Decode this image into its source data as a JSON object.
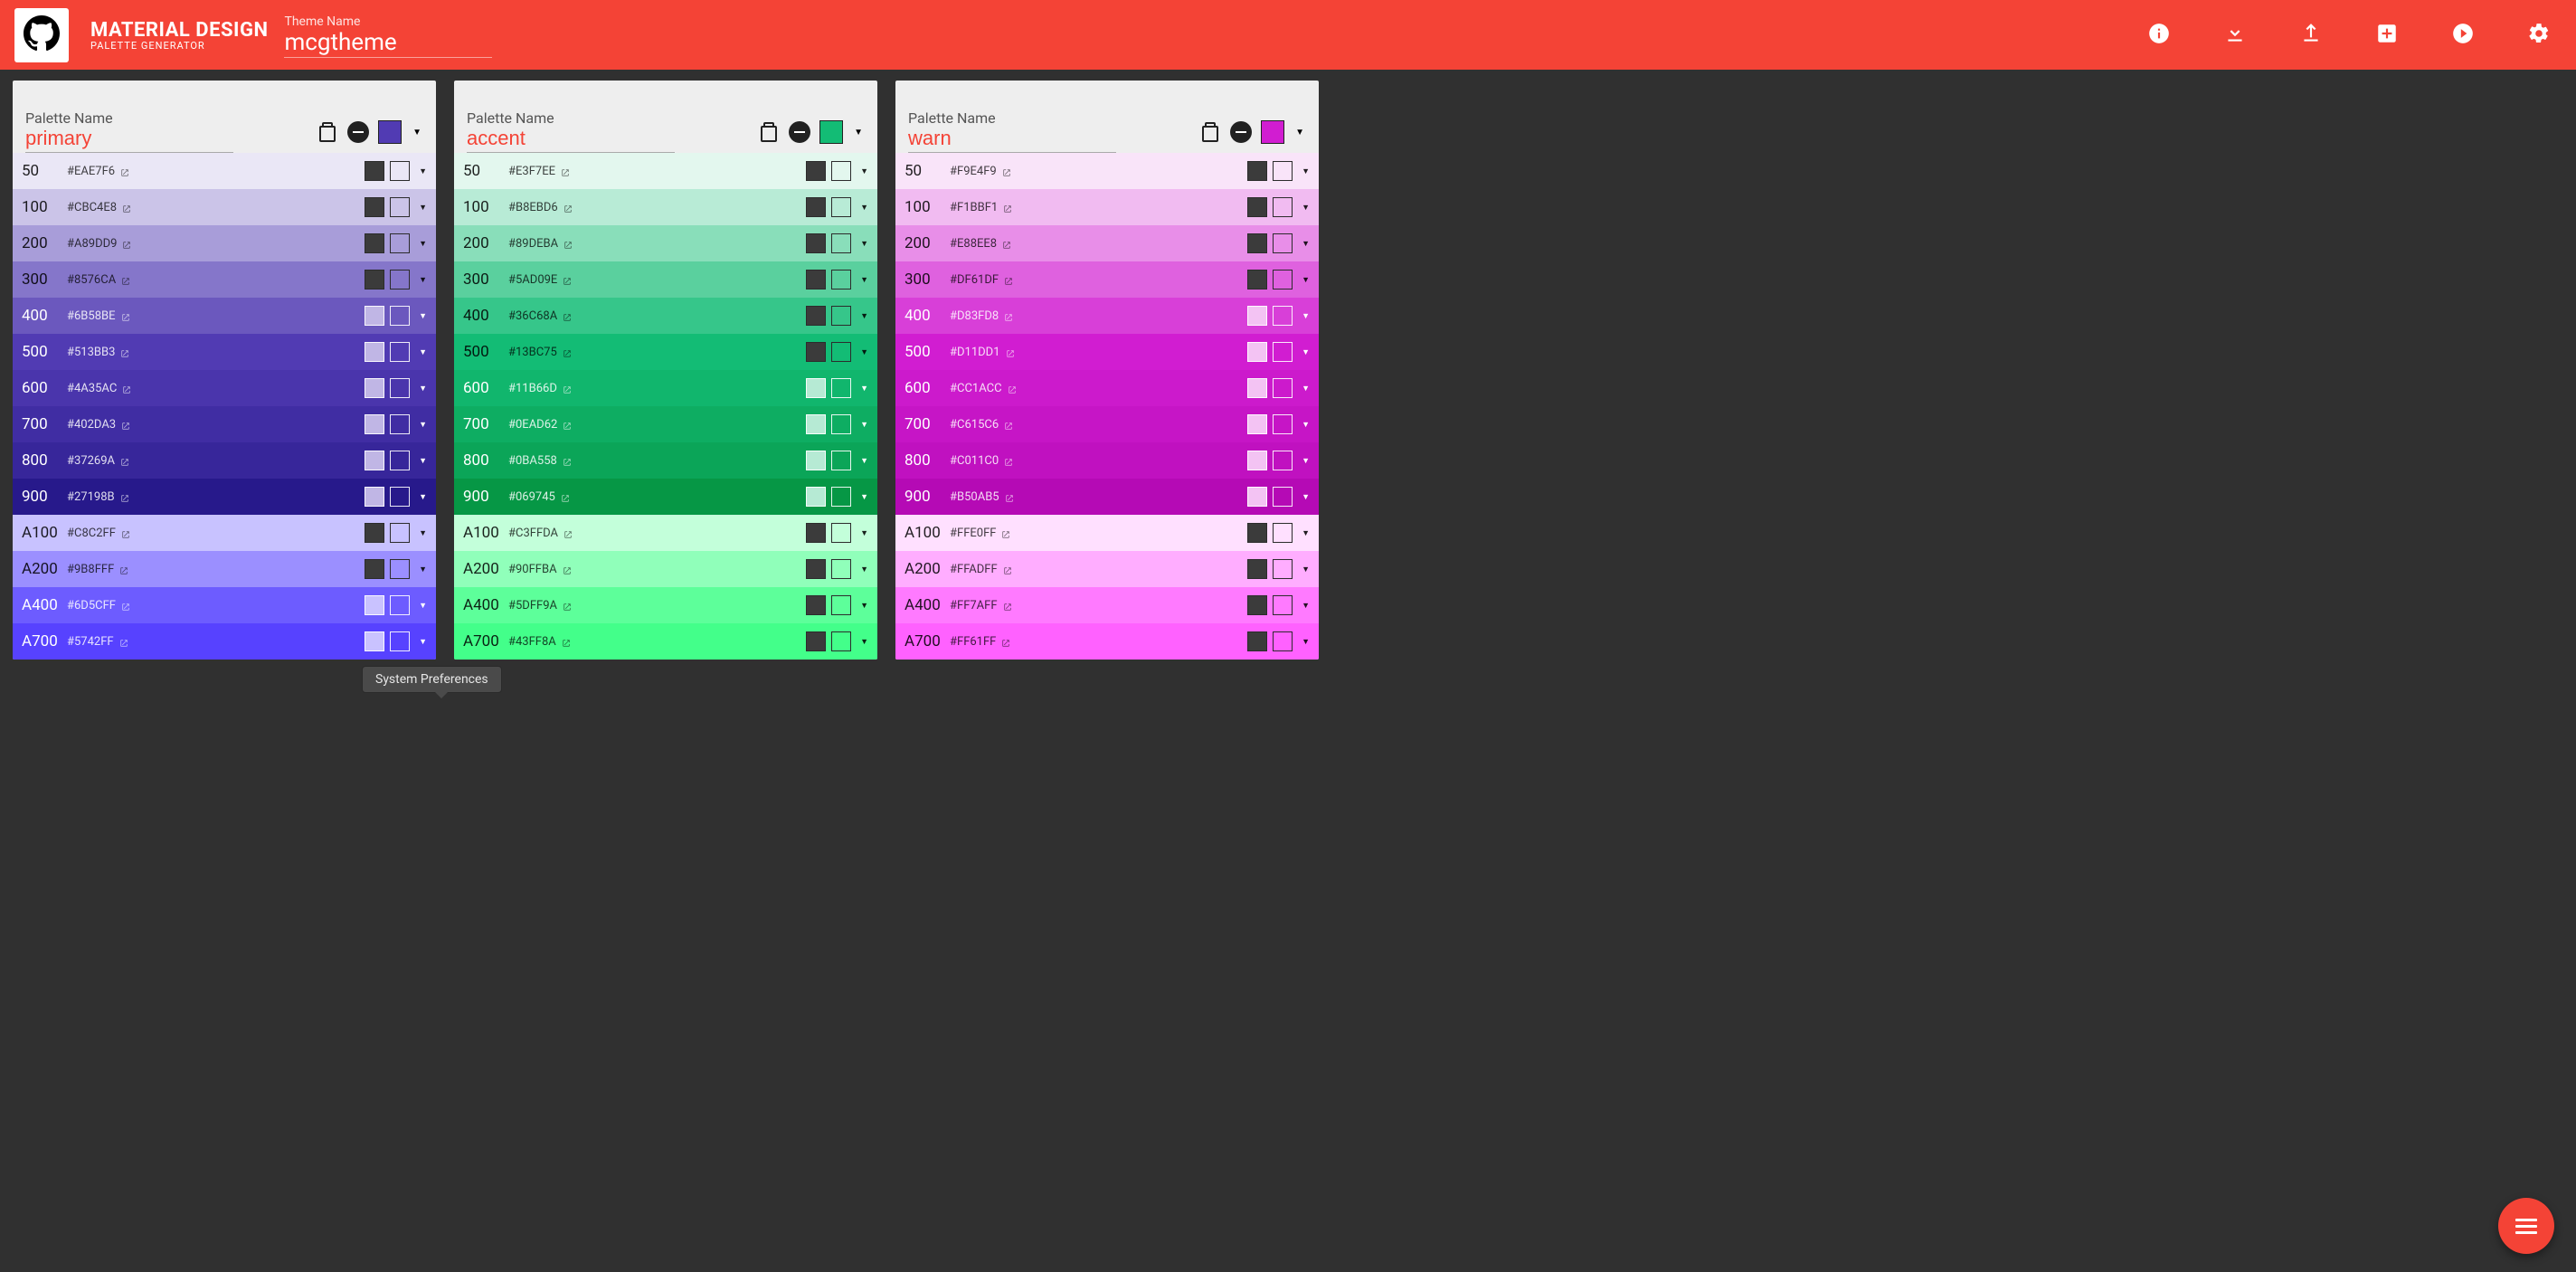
{
  "app": {
    "title_line1": "MATERIAL DESIGN",
    "title_line2": "PALETTE GENERATOR",
    "theme_label": "Theme Name",
    "theme_value": "mcgtheme",
    "palette_label": "Palette Name"
  },
  "tooltip": "System Preferences",
  "palettes": [
    {
      "name": "primary",
      "base": "#513BB3",
      "shades": [
        {
          "label": "50",
          "hex": "#EAE7F6",
          "bg": "#EAE7F6",
          "dark": true,
          "sw": "#EAE7F6"
        },
        {
          "label": "100",
          "hex": "#CBC4E8",
          "bg": "#CBC4E8",
          "dark": true,
          "sw": "#CBC4E8"
        },
        {
          "label": "200",
          "hex": "#A89DD9",
          "bg": "#A89DD9",
          "dark": true,
          "sw": "#A89DD9"
        },
        {
          "label": "300",
          "hex": "#8576CA",
          "bg": "#8576CA",
          "dark": true,
          "sw": "#8576CA"
        },
        {
          "label": "400",
          "hex": "#6B58BE",
          "bg": "#6B58BE",
          "dark": false,
          "sw": "#C0B6E5"
        },
        {
          "label": "500",
          "hex": "#513BB3",
          "bg": "#513BB3",
          "dark": false,
          "sw": "#C0B6E5"
        },
        {
          "label": "600",
          "hex": "#4A35AC",
          "bg": "#4A35AC",
          "dark": false,
          "sw": "#C0B6E5"
        },
        {
          "label": "700",
          "hex": "#402DA3",
          "bg": "#402DA3",
          "dark": false,
          "sw": "#C0B6E5"
        },
        {
          "label": "800",
          "hex": "#37269A",
          "bg": "#37269A",
          "dark": false,
          "sw": "#C0B6E5"
        },
        {
          "label": "900",
          "hex": "#27198B",
          "bg": "#27198B",
          "dark": false,
          "sw": "#C0B6E5"
        },
        {
          "label": "A100",
          "hex": "#C8C2FF",
          "bg": "#C8C2FF",
          "dark": true,
          "sw": "#C8C2FF"
        },
        {
          "label": "A200",
          "hex": "#9B8FFF",
          "bg": "#9B8FFF",
          "dark": true,
          "sw": "#9B8FFF"
        },
        {
          "label": "A400",
          "hex": "#6D5CFF",
          "bg": "#6D5CFF",
          "dark": false,
          "sw": "#C9C2FF"
        },
        {
          "label": "A700",
          "hex": "#5742FF",
          "bg": "#5742FF",
          "dark": false,
          "sw": "#C9C2FF"
        }
      ]
    },
    {
      "name": "accent",
      "base": "#13BC75",
      "shades": [
        {
          "label": "50",
          "hex": "#E3F7EE",
          "bg": "#E3F7EE",
          "dark": true,
          "sw": "#E3F7EE"
        },
        {
          "label": "100",
          "hex": "#B8EBD6",
          "bg": "#B8EBD6",
          "dark": true,
          "sw": "#B8EBD6"
        },
        {
          "label": "200",
          "hex": "#89DEBA",
          "bg": "#89DEBA",
          "dark": true,
          "sw": "#89DEBA"
        },
        {
          "label": "300",
          "hex": "#5AD09E",
          "bg": "#5AD09E",
          "dark": true,
          "sw": "#5AD09E"
        },
        {
          "label": "400",
          "hex": "#36C68A",
          "bg": "#36C68A",
          "dark": true,
          "sw": "#36C68A"
        },
        {
          "label": "500",
          "hex": "#13BC75",
          "bg": "#13BC75",
          "dark": true,
          "sw": "#13BC75"
        },
        {
          "label": "600",
          "hex": "#11B66D",
          "bg": "#11B66D",
          "dark": false,
          "sw": "#B6EAD4"
        },
        {
          "label": "700",
          "hex": "#0EAD62",
          "bg": "#0EAD62",
          "dark": false,
          "sw": "#B6EAD4"
        },
        {
          "label": "800",
          "hex": "#0BA558",
          "bg": "#0BA558",
          "dark": false,
          "sw": "#B6EAD4"
        },
        {
          "label": "900",
          "hex": "#069745",
          "bg": "#069745",
          "dark": false,
          "sw": "#B6EAD4"
        },
        {
          "label": "A100",
          "hex": "#C3FFDA",
          "bg": "#C3FFDA",
          "dark": true,
          "sw": "#C3FFDA"
        },
        {
          "label": "A200",
          "hex": "#90FFBA",
          "bg": "#90FFBA",
          "dark": true,
          "sw": "#90FFBA"
        },
        {
          "label": "A400",
          "hex": "#5DFF9A",
          "bg": "#5DFF9A",
          "dark": true,
          "sw": "#5DFF9A"
        },
        {
          "label": "A700",
          "hex": "#43FF8A",
          "bg": "#43FF8A",
          "dark": true,
          "sw": "#43FF8A"
        }
      ]
    },
    {
      "name": "warn",
      "base": "#D11DD1",
      "shades": [
        {
          "label": "50",
          "hex": "#F9E4F9",
          "bg": "#F9E4F9",
          "dark": true,
          "sw": "#F9E4F9"
        },
        {
          "label": "100",
          "hex": "#F1BBF1",
          "bg": "#F1BBF1",
          "dark": true,
          "sw": "#F1BBF1"
        },
        {
          "label": "200",
          "hex": "#E88EE8",
          "bg": "#E88EE8",
          "dark": true,
          "sw": "#E88EE8"
        },
        {
          "label": "300",
          "hex": "#DF61DF",
          "bg": "#DF61DF",
          "dark": true,
          "sw": "#DF61DF"
        },
        {
          "label": "400",
          "hex": "#D83FD8",
          "bg": "#D83FD8",
          "dark": false,
          "sw": "#F3C3F3"
        },
        {
          "label": "500",
          "hex": "#D11DD1",
          "bg": "#D11DD1",
          "dark": false,
          "sw": "#F3C3F3"
        },
        {
          "label": "600",
          "hex": "#CC1ACC",
          "bg": "#CC1ACC",
          "dark": false,
          "sw": "#F3C3F3"
        },
        {
          "label": "700",
          "hex": "#C615C6",
          "bg": "#C615C6",
          "dark": false,
          "sw": "#F3C3F3"
        },
        {
          "label": "800",
          "hex": "#C011C0",
          "bg": "#C011C0",
          "dark": false,
          "sw": "#F3C3F3"
        },
        {
          "label": "900",
          "hex": "#B50AB5",
          "bg": "#B50AB5",
          "dark": false,
          "sw": "#F3C3F3"
        },
        {
          "label": "A100",
          "hex": "#FFE0FF",
          "bg": "#FFE0FF",
          "dark": true,
          "sw": "#FFE0FF"
        },
        {
          "label": "A200",
          "hex": "#FFADFF",
          "bg": "#FFADFF",
          "dark": true,
          "sw": "#FFADFF"
        },
        {
          "label": "A400",
          "hex": "#FF7AFF",
          "bg": "#FF7AFF",
          "dark": true,
          "sw": "#FF7AFF"
        },
        {
          "label": "A700",
          "hex": "#FF61FF",
          "bg": "#FF61FF",
          "dark": true,
          "sw": "#FF61FF"
        }
      ]
    }
  ]
}
